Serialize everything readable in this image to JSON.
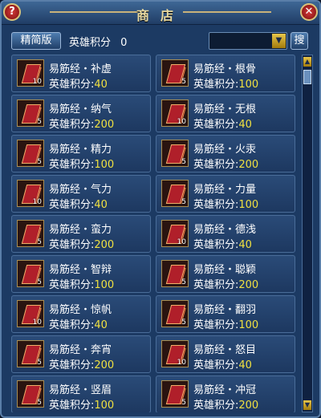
{
  "window": {
    "title": "商店",
    "help_label": "?",
    "close_label": "✕"
  },
  "toolbar": {
    "simple_label": "精简版",
    "points_label": "英雄积分",
    "points_value": "0",
    "search_button": "搜",
    "dropdown_icon": "▼"
  },
  "items": [
    {
      "name": "易筋经・补虚",
      "qty": "10",
      "label": "英雄积分:",
      "value": "40"
    },
    {
      "name": "易筋经・根骨",
      "qty": "5",
      "label": "英雄积分:",
      "value": "100"
    },
    {
      "name": "易筋经・纳气",
      "qty": "5",
      "label": "英雄积分:",
      "value": "200"
    },
    {
      "name": "易筋经・无根",
      "qty": "10",
      "label": "英雄积分:",
      "value": "40"
    },
    {
      "name": "易筋经・精力",
      "qty": "5",
      "label": "英雄积分:",
      "value": "100"
    },
    {
      "name": "易筋经・火汞",
      "qty": "5",
      "label": "英雄积分:",
      "value": "200"
    },
    {
      "name": "易筋经・气力",
      "qty": "10",
      "label": "英雄积分:",
      "value": "40"
    },
    {
      "name": "易筋经・力量",
      "qty": "5",
      "label": "英雄积分:",
      "value": "100"
    },
    {
      "name": "易筋经・蛮力",
      "qty": "5",
      "label": "英雄积分:",
      "value": "200"
    },
    {
      "name": "易筋经・德浅",
      "qty": "10",
      "label": "英雄积分:",
      "value": "40"
    },
    {
      "name": "易筋经・智辩",
      "qty": "5",
      "label": "英雄积分:",
      "value": "100"
    },
    {
      "name": "易筋经・聪颖",
      "qty": "5",
      "label": "英雄积分:",
      "value": "200"
    },
    {
      "name": "易筋经・惊帆",
      "qty": "10",
      "label": "英雄积分:",
      "value": "40"
    },
    {
      "name": "易筋经・翻羽",
      "qty": "5",
      "label": "英雄积分:",
      "value": "100"
    },
    {
      "name": "易筋经・奔宵",
      "qty": "5",
      "label": "英雄积分:",
      "value": "200"
    },
    {
      "name": "易筋经・怒目",
      "qty": "10",
      "label": "英雄积分:",
      "value": "40"
    },
    {
      "name": "易筋经・竖眉",
      "qty": "5",
      "label": "英雄积分:",
      "value": "100"
    },
    {
      "name": "易筋经・冲冠",
      "qty": "5",
      "label": "英雄积分:",
      "value": "200"
    }
  ],
  "scrollbar": {
    "up_icon": "▲",
    "down_icon": "▼"
  }
}
